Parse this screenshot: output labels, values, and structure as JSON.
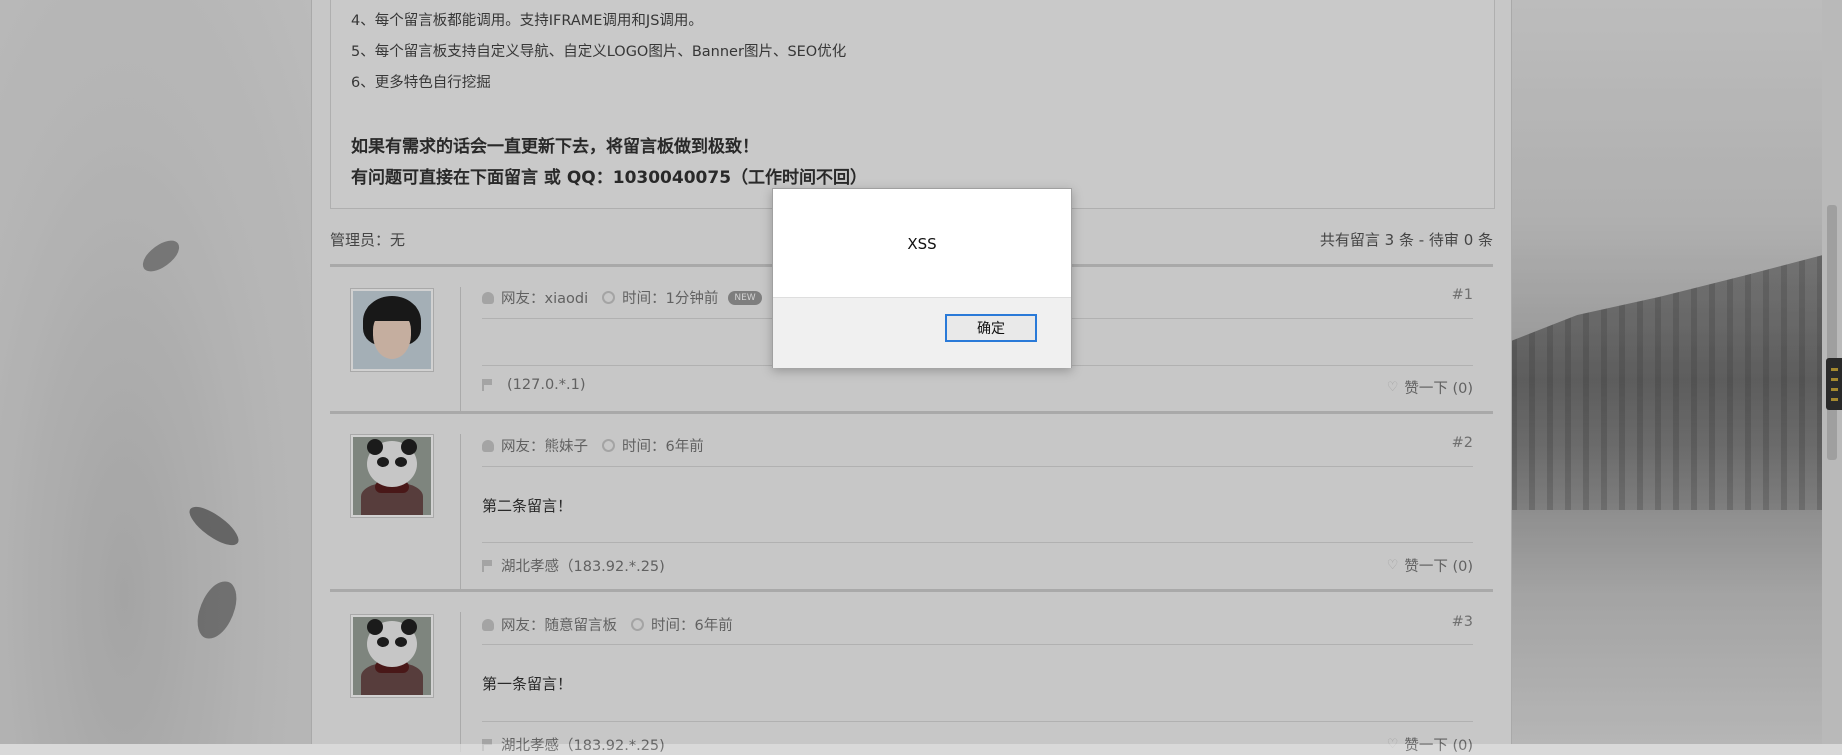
{
  "intro": {
    "lines": [
      "4、每个留言板都能调用。支持IFRAME调用和JS调用。",
      "5、每个留言板支持自定义导航、自定义LOGO图片、Banner图片、SEO优化",
      "6、更多特色自行挖掘"
    ],
    "strong_lines": [
      "如果有需求的话会一直更新下去，将留言板做到极致！",
      "有问题可直接在下面留言 或 QQ：1030040075（工作时间不回）"
    ]
  },
  "admin_text": "管理员：无",
  "count_text": "共有留言 3 条 - 待审 0 条",
  "messages": [
    {
      "user": "网友：xiaodi",
      "time": "时间：1分钟前",
      "badge": "NEW",
      "number": "#1",
      "content": "",
      "location": "(127.0.*.1)",
      "like": "赞一下  (0)",
      "avatar": "girl-avatar"
    },
    {
      "user": "网友：熊妹子",
      "time": "时间：6年前",
      "number": "#2",
      "content": "第二条留言！",
      "location": "湖北孝感（183.92.*.25)",
      "like": "赞一下  (0)",
      "avatar": "panda-avatar"
    },
    {
      "user": "网友：随意留言板",
      "time": "时间：6年前",
      "number": "#3",
      "content": "第一条留言！",
      "location": "湖北孝感（183.92.*.25)",
      "like": "赞一下  (0)",
      "avatar": "panda-avatar"
    }
  ],
  "dialog": {
    "message": "XSS",
    "ok_label": "确定"
  },
  "colors": {
    "dialog_button_border": "#2a7ad8",
    "overlay": "rgba(0,0,0,0.18)"
  }
}
